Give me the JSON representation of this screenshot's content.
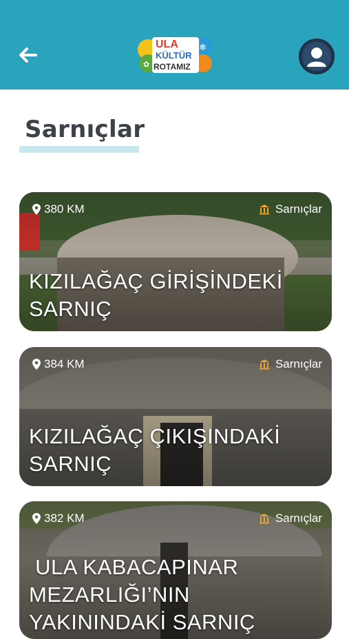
{
  "header": {
    "back_icon": "arrow-left-icon",
    "logo": {
      "line1": "ULA",
      "line2": "KÜLTÜR",
      "line3": "ROTAMIZ"
    },
    "avatar_icon": "user-avatar-icon",
    "colors": {
      "bar": "#2aa3bd",
      "avatar": "#1f3a57"
    }
  },
  "page": {
    "title": "Sarnıçlar"
  },
  "cards": [
    {
      "distance": "380 KM",
      "category": "Sarnıçlar",
      "title": "KIZILAĞAÇ GİRİŞİNDEKİ SARNIÇ"
    },
    {
      "distance": "384 KM",
      "category": "Sarnıçlar",
      "title": "KIZILAĞAÇ ÇIKIŞINDAKİ SARNIÇ"
    },
    {
      "distance": "382 KM",
      "category": "Sarnıçlar",
      "title": " ULA KABACAPINAR MEZARLIĞI’NIN YAKININDAKİ SARNIÇ"
    }
  ]
}
